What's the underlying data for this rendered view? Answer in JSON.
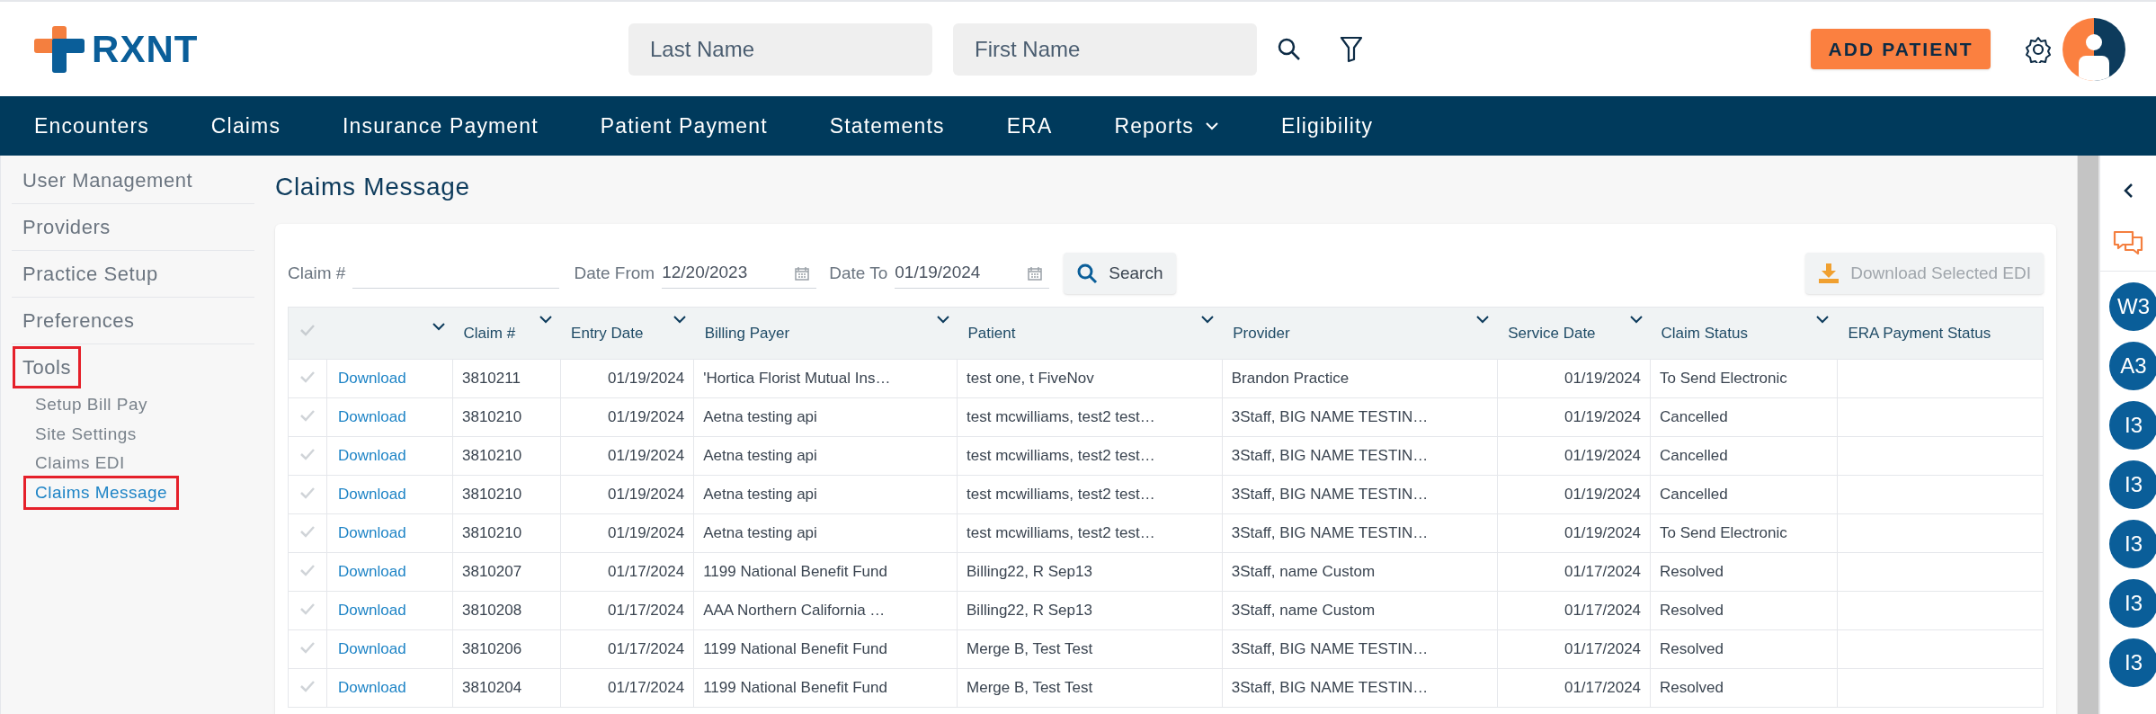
{
  "header": {
    "logo": "RXNT",
    "last_name": {
      "placeholder": "Last Name"
    },
    "first_name": {
      "placeholder": "First Name"
    },
    "add_patient": "ADD PATIENT"
  },
  "nav": [
    {
      "label": "Encounters",
      "dropdown": false
    },
    {
      "label": "Claims",
      "dropdown": false
    },
    {
      "label": "Insurance Payment",
      "dropdown": false
    },
    {
      "label": "Patient Payment",
      "dropdown": false
    },
    {
      "label": "Statements",
      "dropdown": false
    },
    {
      "label": "ERA",
      "dropdown": false
    },
    {
      "label": "Reports",
      "dropdown": true
    },
    {
      "label": "Eligibility",
      "dropdown": false
    }
  ],
  "sidebar": {
    "items": [
      {
        "label": "User Management",
        "highlighted": false
      },
      {
        "label": "Providers",
        "highlighted": false
      },
      {
        "label": "Practice Setup",
        "highlighted": false
      },
      {
        "label": "Preferences",
        "highlighted": false
      },
      {
        "label": "Tools",
        "highlighted": true,
        "children": [
          {
            "label": "Setup Bill Pay",
            "selected": false,
            "highlighted": false
          },
          {
            "label": "Site Settings",
            "selected": false,
            "highlighted": false
          },
          {
            "label": "Claims EDI",
            "selected": false,
            "highlighted": false
          },
          {
            "label": "Claims Message",
            "selected": true,
            "highlighted": true
          }
        ]
      }
    ]
  },
  "page_title": "Claims Message",
  "filters": {
    "claim_label": "Claim #",
    "date_from_label": "Date From",
    "date_from": "12/20/2023",
    "date_to_label": "Date To",
    "date_to": "01/19/2024",
    "search_button": "Search",
    "download_button": {
      "label": "Download Selected EDI",
      "disabled": true
    }
  },
  "table": {
    "columns": [
      "Claim #",
      "Entry Date",
      "Billing Payer",
      "Patient",
      "Provider",
      "Service Date",
      "Claim Status",
      "ERA Payment Status"
    ],
    "rows": [
      {
        "selected": false,
        "link": "Download",
        "cells": [
          "3810211",
          "01/19/2024",
          "'Hortica Florist Mutual Ins…",
          "test one, t FiveNov",
          "Brandon Practice",
          "01/19/2024",
          "To Send Electronic"
        ]
      },
      {
        "selected": false,
        "link": "Download",
        "cells": [
          "3810210",
          "01/19/2024",
          "Aetna testing api",
          "test mcwilliams, test2 test…",
          "3Staff, BIG NAME TESTIN…",
          "01/19/2024",
          "Cancelled"
        ]
      },
      {
        "selected": false,
        "link": "Download",
        "cells": [
          "3810210",
          "01/19/2024",
          "Aetna testing api",
          "test mcwilliams, test2 test…",
          "3Staff, BIG NAME TESTIN…",
          "01/19/2024",
          "Cancelled"
        ]
      },
      {
        "selected": false,
        "link": "Download",
        "cells": [
          "3810210",
          "01/19/2024",
          "Aetna testing api",
          "test mcwilliams, test2 test…",
          "3Staff, BIG NAME TESTIN…",
          "01/19/2024",
          "Cancelled"
        ]
      },
      {
        "selected": false,
        "link": "Download",
        "cells": [
          "3810210",
          "01/19/2024",
          "Aetna testing api",
          "test mcwilliams, test2 test…",
          "3Staff, BIG NAME TESTIN…",
          "01/19/2024",
          "To Send Electronic"
        ]
      },
      {
        "selected": false,
        "link": "Download",
        "cells": [
          "3810207",
          "01/17/2024",
          "1199 National Benefit Fund",
          "Billing22, R Sep13",
          "3Staff, name Custom",
          "01/17/2024",
          "Resolved"
        ]
      },
      {
        "selected": false,
        "link": "Download",
        "cells": [
          "3810208",
          "01/17/2024",
          "AAA Northern California …",
          "Billing22, R Sep13",
          "3Staff, name Custom",
          "01/17/2024",
          "Resolved"
        ]
      },
      {
        "selected": false,
        "link": "Download",
        "cells": [
          "3810206",
          "01/17/2024",
          "1199 National Benefit Fund",
          "Merge B, Test Test",
          "3Staff, BIG NAME TESTIN…",
          "01/17/2024",
          "Resolved"
        ]
      },
      {
        "selected": false,
        "link": "Download",
        "cells": [
          "3810204",
          "01/17/2024",
          "1199 National Benefit Fund",
          "Merge B, Test Test",
          "3Staff, BIG NAME TESTIN…",
          "01/17/2024",
          "Resolved"
        ]
      }
    ]
  },
  "right_rail": {
    "users": [
      "W3",
      "A3",
      "I3",
      "I3",
      "I3",
      "I3",
      "I3"
    ]
  }
}
